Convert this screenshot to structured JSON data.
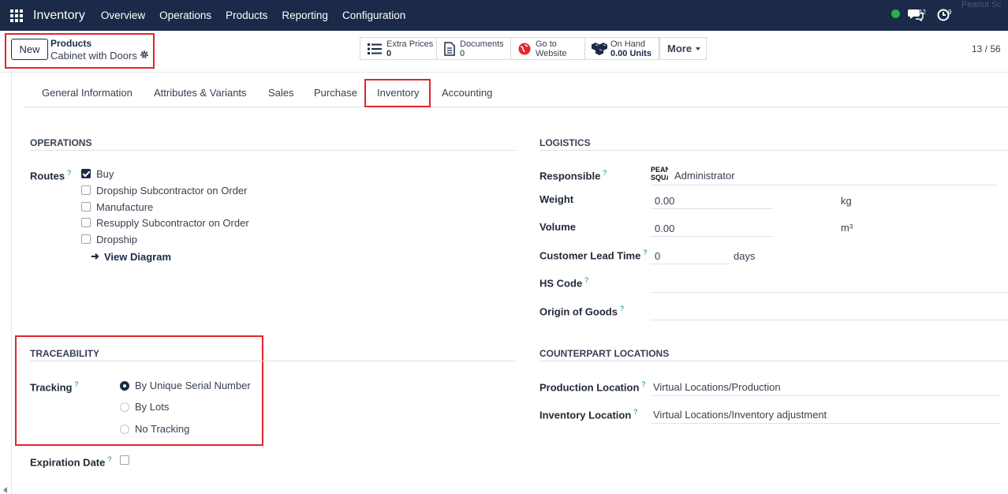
{
  "navbar": {
    "brand": "Inventory",
    "menu": [
      "Overview",
      "Operations",
      "Products",
      "Reporting",
      "Configuration"
    ],
    "chat_count": "12",
    "activity_count": "9",
    "user_ghost": "Peanut Sc",
    "status_color": "#21b249",
    "background": "#1b2a49"
  },
  "control": {
    "new_label": "New",
    "breadcrumb_parent": "Products",
    "breadcrumb_current": "Cabinet with Doors",
    "smart_buttons": [
      {
        "icon": "list-icon",
        "label": "Extra Prices",
        "value": "0"
      },
      {
        "icon": "document-icon",
        "label": "Documents",
        "value": "0"
      },
      {
        "icon": "globe-icon",
        "label": "Go to",
        "value": "Website"
      },
      {
        "icon": "cubes-icon",
        "label": "On Hand",
        "value": "0.00 Units"
      }
    ],
    "more_label": "More",
    "pager": "13 / 56"
  },
  "tabs": [
    "General Information",
    "Attributes & Variants",
    "Sales",
    "Purchase",
    "Inventory",
    "Accounting"
  ],
  "active_tab": "Inventory",
  "operations": {
    "title": "OPERATIONS",
    "routes_label": "Routes",
    "routes": [
      {
        "label": "Buy",
        "checked": true
      },
      {
        "label": "Dropship Subcontractor on Order",
        "checked": false
      },
      {
        "label": "Manufacture",
        "checked": false
      },
      {
        "label": "Resupply Subcontractor on Order",
        "checked": false
      },
      {
        "label": "Dropship",
        "checked": false
      }
    ],
    "view_diagram": "View Diagram"
  },
  "traceability": {
    "title": "TRACEABILITY",
    "tracking_label": "Tracking",
    "options": [
      {
        "label": "By Unique Serial Number",
        "selected": true
      },
      {
        "label": "By Lots",
        "selected": false
      },
      {
        "label": "No Tracking",
        "selected": false
      }
    ],
    "expiration_label": "Expiration Date"
  },
  "logistics": {
    "title": "LOGISTICS",
    "responsible_label": "Responsible",
    "responsible_avatar": "PEANUT SQUAD",
    "responsible_value": "Administrator",
    "weight_label": "Weight",
    "weight_value": "0.00",
    "weight_unit": "kg",
    "volume_label": "Volume",
    "volume_value": "0.00",
    "volume_unit": "m³",
    "lead_time_label": "Customer Lead Time",
    "lead_time_value": "0",
    "lead_time_unit": "days",
    "hs_code_label": "HS Code",
    "origin_label": "Origin of Goods"
  },
  "counterpart": {
    "title": "COUNTERPART LOCATIONS",
    "production_label": "Production Location",
    "production_value": "Virtual Locations/Production",
    "inventory_label": "Inventory Location",
    "inventory_value": "Virtual Locations/Inventory adjustment"
  }
}
